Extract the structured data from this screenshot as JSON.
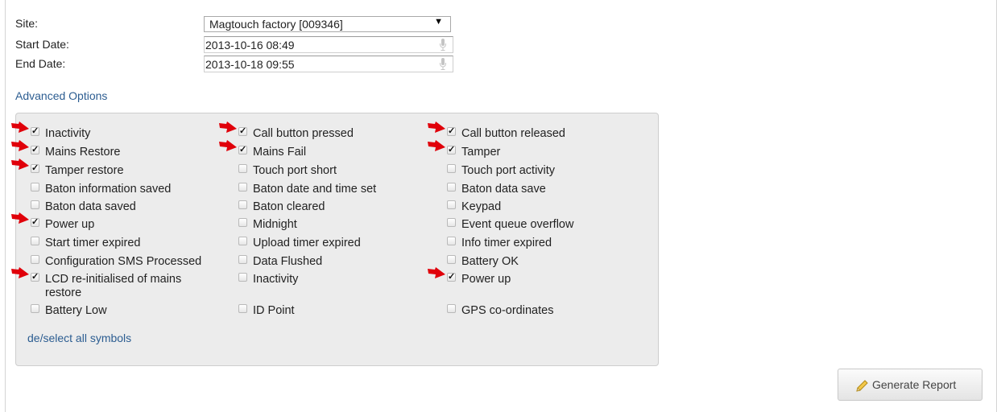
{
  "form": {
    "site_label": "Site:",
    "site_value": "Magtouch factory [009346]",
    "start_label": "Start Date:",
    "start_value": "2013-10-16 08:49",
    "end_label": "End Date:",
    "end_value": "2013-10-18 09:55"
  },
  "advanced_options_label": "Advanced Options",
  "select_all_label": "de/select all symbols",
  "generate_label": "Generate Report",
  "options": {
    "col1": [
      {
        "label": "Inactivity",
        "checked": true,
        "marked": true
      },
      {
        "label": "Mains Restore",
        "checked": true,
        "marked": true
      },
      {
        "label": "Tamper restore",
        "checked": true,
        "marked": true
      },
      {
        "label": "Baton information saved",
        "checked": false,
        "marked": false
      },
      {
        "label": "Baton data saved",
        "checked": false,
        "marked": false
      },
      {
        "label": "Power up",
        "checked": true,
        "marked": true
      },
      {
        "label": "Start timer expired",
        "checked": false,
        "marked": false
      },
      {
        "label": "Configuration SMS Processed",
        "checked": false,
        "marked": false
      },
      {
        "label": "LCD re-initialised of mains",
        "label2": "restore",
        "checked": true,
        "marked": true
      },
      {
        "label": "Battery Low",
        "checked": false,
        "marked": false
      }
    ],
    "col2": [
      {
        "label": "Call button pressed",
        "checked": true,
        "marked": true
      },
      {
        "label": "Mains Fail",
        "checked": true,
        "marked": true
      },
      {
        "label": "Touch port short",
        "checked": false,
        "marked": false
      },
      {
        "label": "Baton date and time set",
        "checked": false,
        "marked": false
      },
      {
        "label": "Baton cleared",
        "checked": false,
        "marked": false
      },
      {
        "label": "Midnight",
        "checked": false,
        "marked": false
      },
      {
        "label": "Upload timer expired",
        "checked": false,
        "marked": false
      },
      {
        "label": "Data Flushed",
        "checked": false,
        "marked": false
      },
      {
        "label": "Inactivity",
        "checked": false,
        "marked": false
      },
      {
        "label": "ID Point",
        "checked": false,
        "marked": false
      }
    ],
    "col3": [
      {
        "label": "Call button released",
        "checked": true,
        "marked": true
      },
      {
        "label": "Tamper",
        "checked": true,
        "marked": true
      },
      {
        "label": "Touch port activity",
        "checked": false,
        "marked": false
      },
      {
        "label": "Baton data save",
        "checked": false,
        "marked": false
      },
      {
        "label": "Keypad",
        "checked": false,
        "marked": false
      },
      {
        "label": "Event queue overflow",
        "checked": false,
        "marked": false
      },
      {
        "label": "Info timer expired",
        "checked": false,
        "marked": false
      },
      {
        "label": "Battery OK",
        "checked": false,
        "marked": false
      },
      {
        "label": "Power up",
        "checked": true,
        "marked": true
      },
      {
        "label": "GPS co-ordinates",
        "checked": false,
        "marked": false
      }
    ]
  },
  "colors": {
    "link": "#2c5d91",
    "annotation_arrow": "#e0000a",
    "panel_bg": "#ececec"
  }
}
